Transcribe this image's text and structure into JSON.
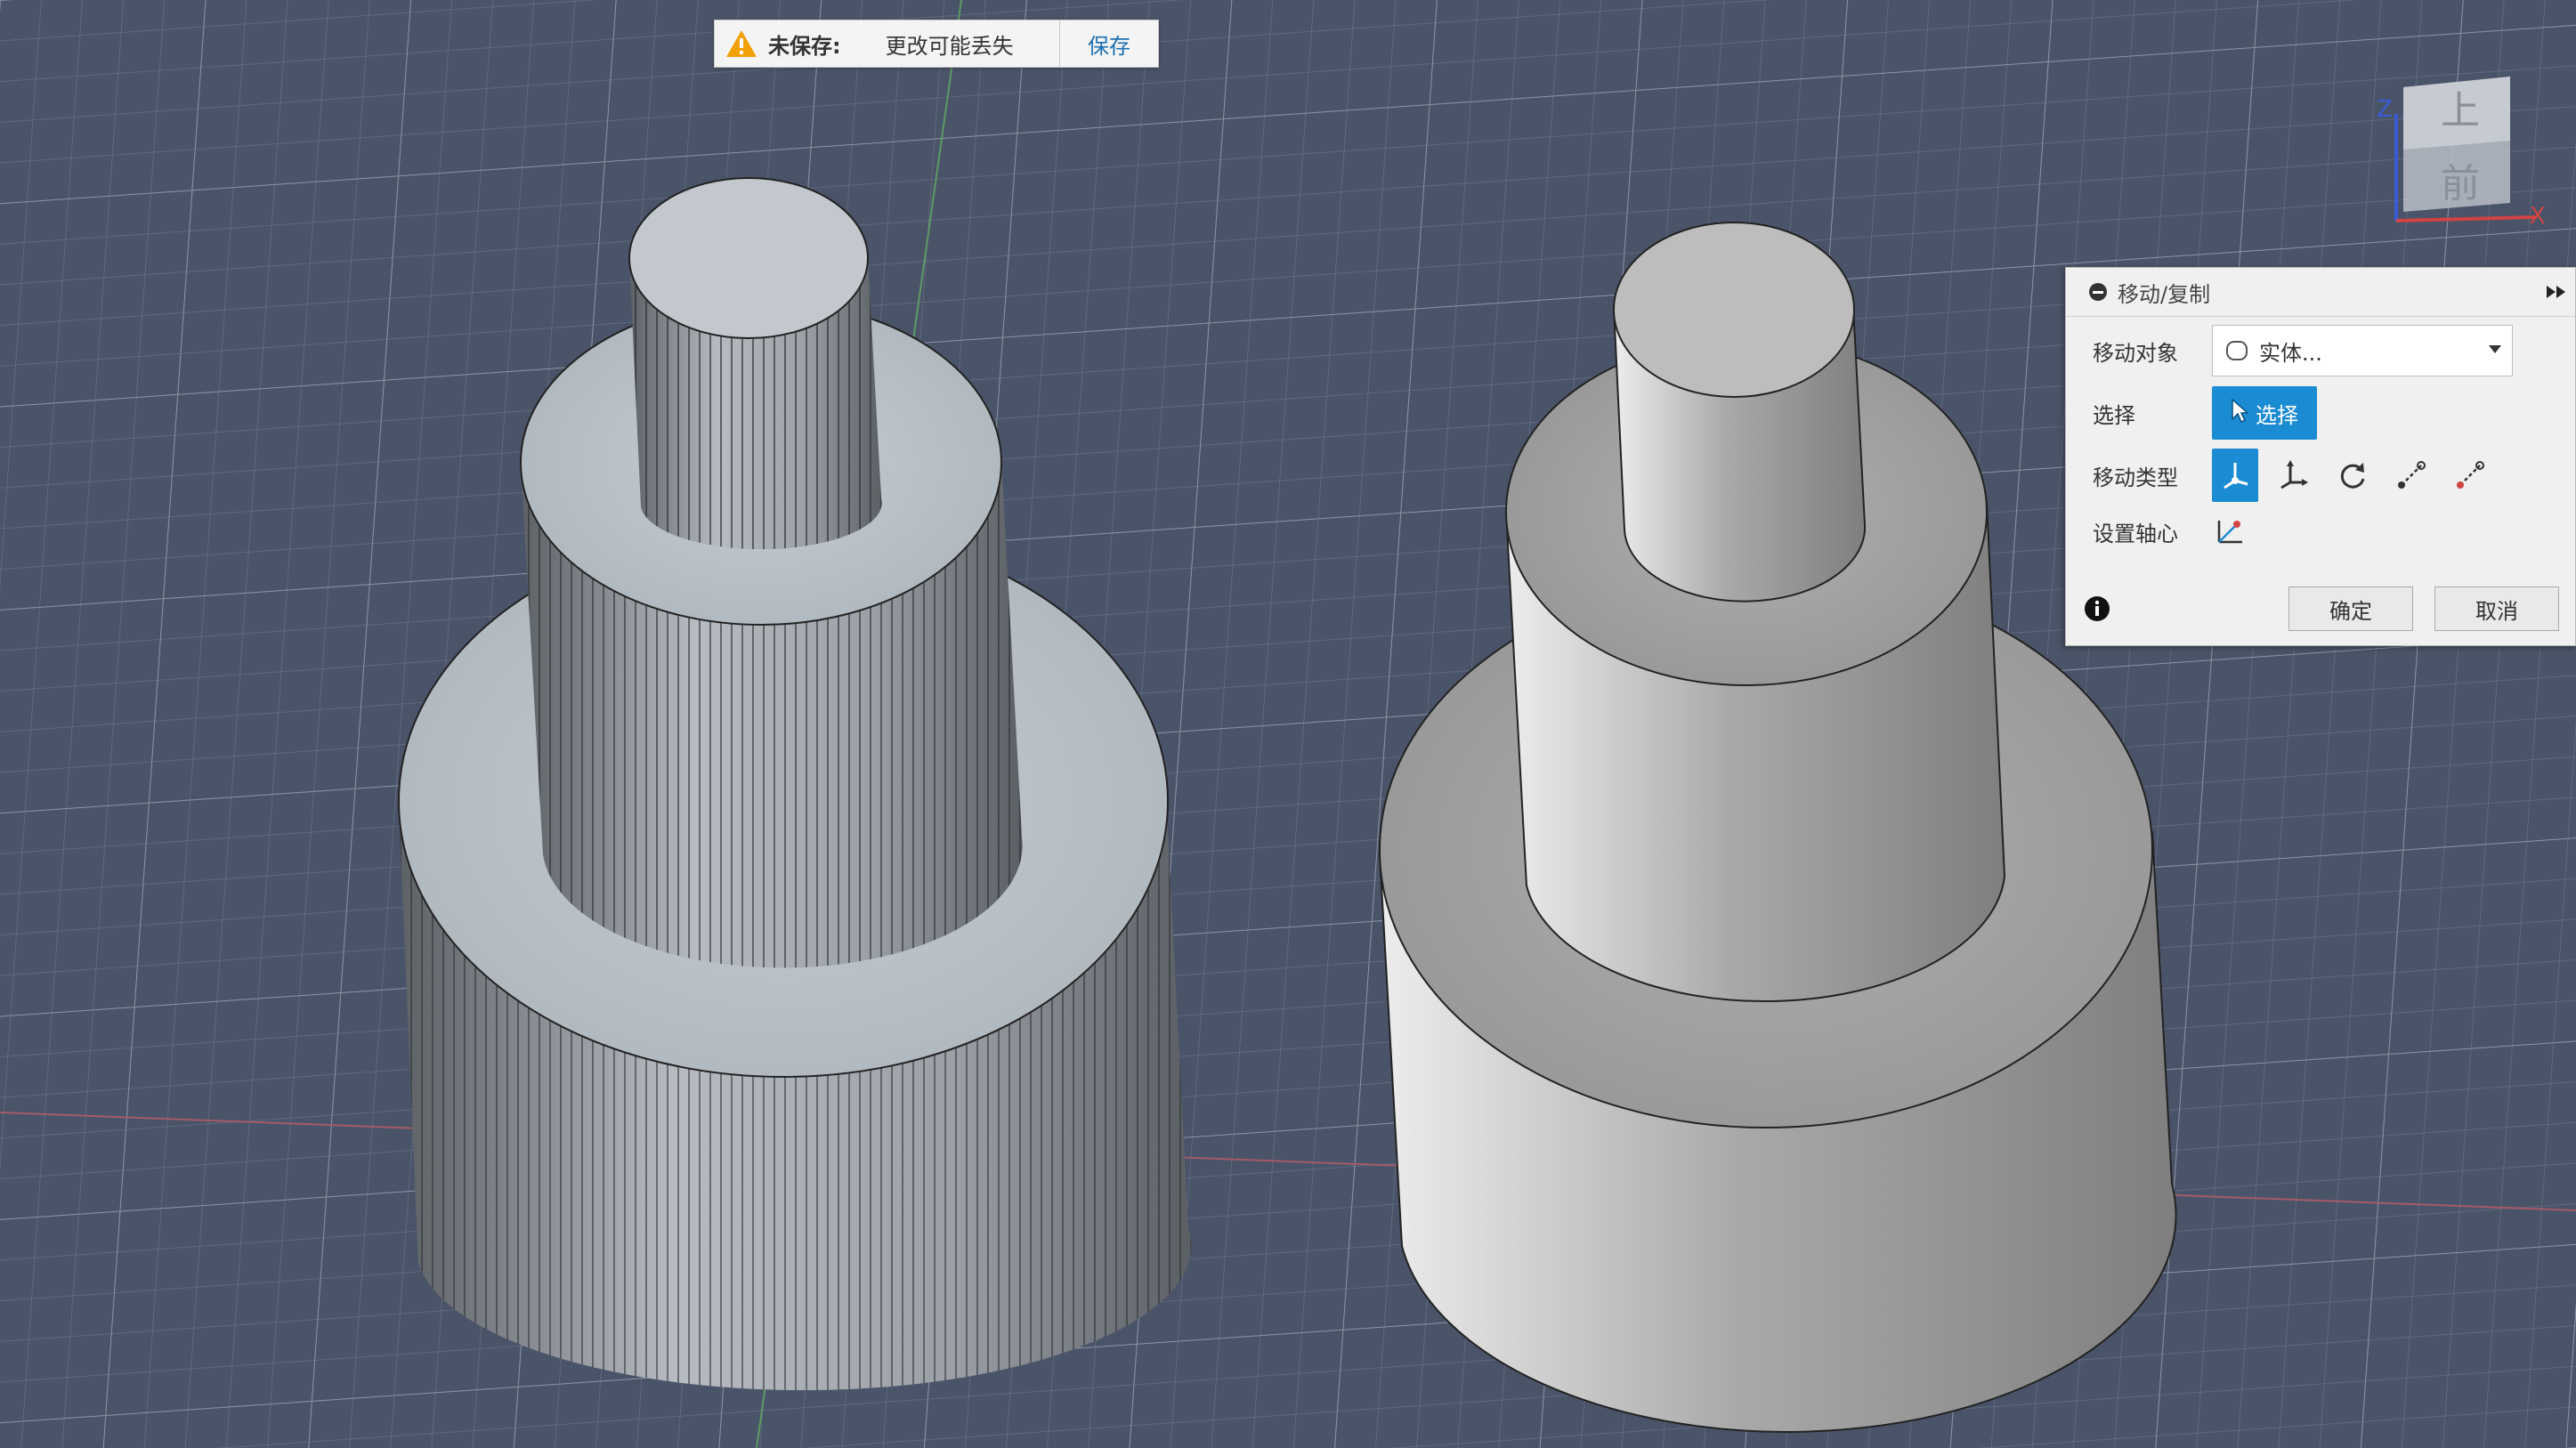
{
  "notification": {
    "title": "未保存:",
    "message": "更改可能丢失",
    "save_label": "保存"
  },
  "viewcube": {
    "top_label": "上",
    "front_label": "前",
    "axis_z": "Z",
    "axis_x": "X"
  },
  "dialog": {
    "title": "移动/复制",
    "move_object": {
      "label": "移动对象",
      "value": "实体..."
    },
    "select": {
      "label": "选择",
      "button_label": "选择"
    },
    "move_type": {
      "label": "移动类型",
      "options": [
        "free-move-icon",
        "translate-icon",
        "rotate-icon",
        "point-to-point-icon",
        "point-to-position-icon"
      ]
    },
    "set_pivot": {
      "label": "设置轴心"
    },
    "ok_label": "确定",
    "cancel_label": "取消"
  },
  "colors": {
    "background": "#4a5468",
    "accent": "#1b8bd3",
    "warning": "#f2a007"
  }
}
